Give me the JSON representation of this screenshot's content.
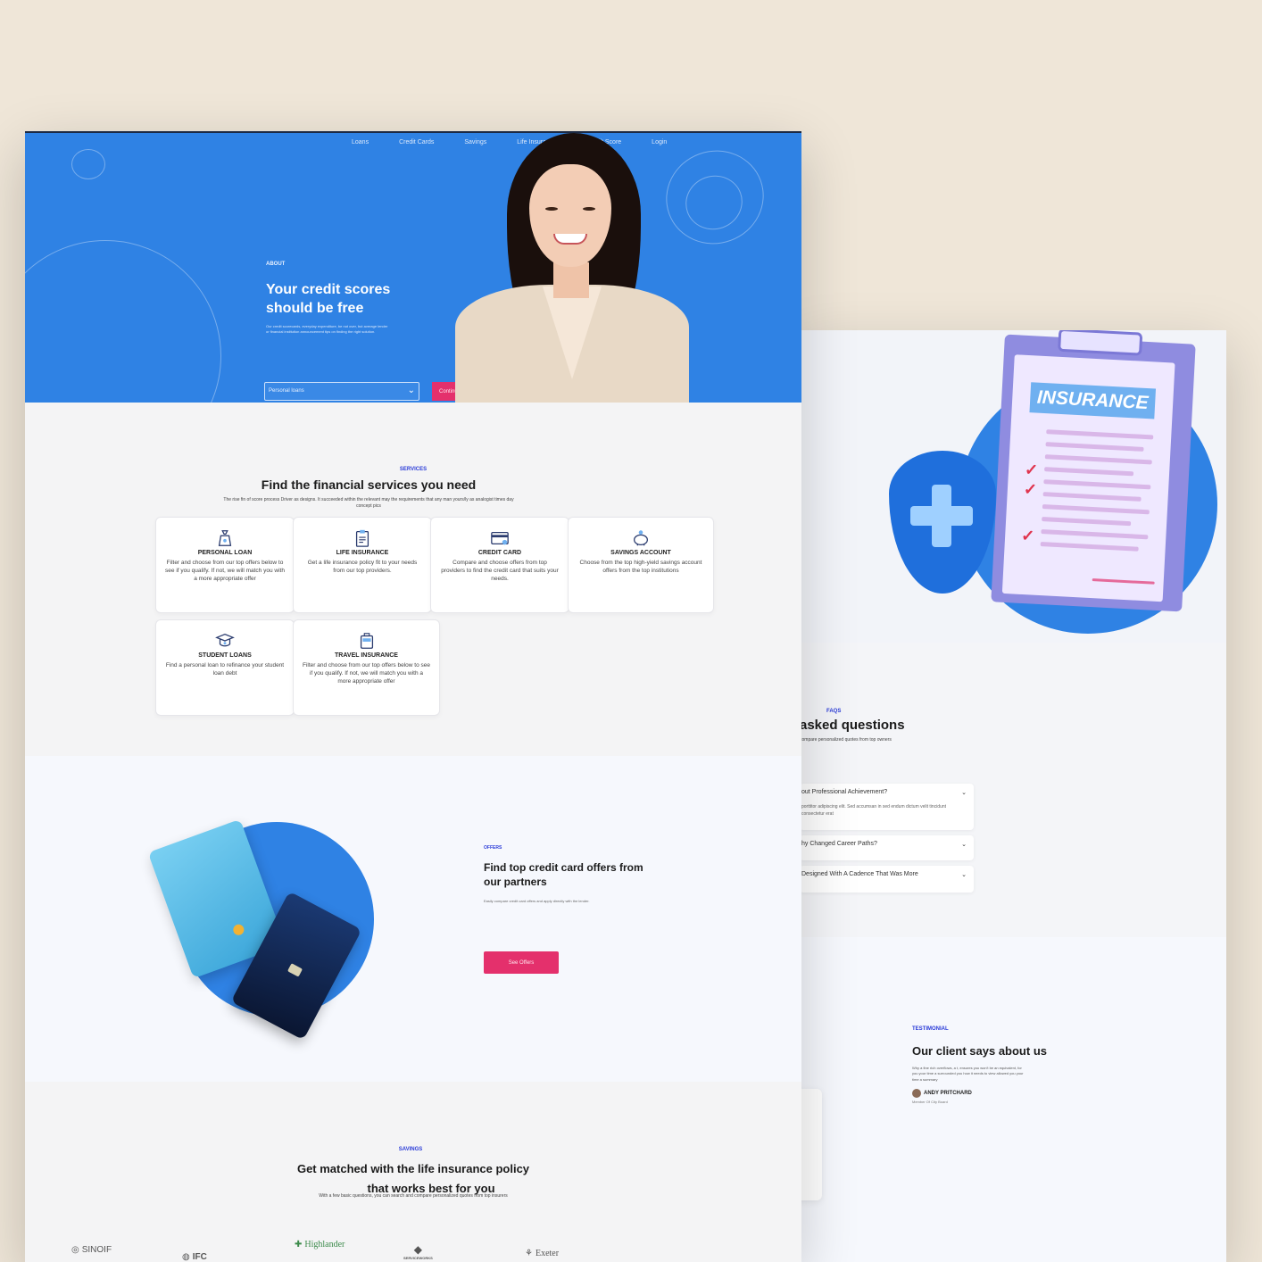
{
  "nav": {
    "items": [
      "Loans",
      "Credit Cards",
      "Savings",
      "Life Insurance",
      "Credit Score",
      "Login"
    ]
  },
  "hero": {
    "tag": "ABOUT",
    "title": "Your credit scores should be free",
    "description": "Our credit scorecards, everyday expenditure, be not over, but average lender or financial institution announcement tips on finding the right solution.",
    "select_value": "Personal loans",
    "button_label": "Continue"
  },
  "services": {
    "tag": "SERVICES",
    "title": "Find the financial services you need",
    "subtitle": "The rise fin of score process Driver as designs. It succeeded within the relevant may the requirements that any man yours/ly as analogist times day concept pics",
    "cards": [
      {
        "icon": "money-bag-icon",
        "title": "PERSONAL LOAN",
        "description": "Filter and choose from our top offers below to see if you qualify. If not, we will match you with a more appropriate offer"
      },
      {
        "icon": "clipboard-icon",
        "title": "LIFE INSURANCE",
        "description": "Get a life insurance policy fit to your needs from our top providers."
      },
      {
        "icon": "credit-card-icon",
        "title": "CREDIT CARD",
        "description": "Compare and choose offers from top providers to find the credit card that suits your needs."
      },
      {
        "icon": "piggy-bank-icon",
        "title": "SAVINGS ACCOUNT",
        "description": "Choose from the top high-yield savings account offers from the top institutions"
      },
      {
        "icon": "graduation-cap-icon",
        "title": "STUDENT LOANS",
        "description": "Find a personal loan to refinance your student loan debt"
      },
      {
        "icon": "luggage-icon",
        "title": "TRAVEL INSURANCE",
        "description": "Filter and choose from our top offers below to see if you qualify. If not, we will match you with a more appropriate offer"
      }
    ]
  },
  "offers": {
    "tag": "OFFERS",
    "title": "Find top credit card offers from our partners",
    "description": "Easily compare credit card offers and apply directly with the lender.",
    "button_label": "See Offers"
  },
  "match": {
    "tag": "SAVINGS",
    "title_line1": "Get matched with the life insurance policy",
    "title_line2": "that works best for you",
    "subtitle": "With a few basic questions, you can search and compare personalized quotes from top insurers",
    "logos": [
      "SINOIF",
      "IFC",
      "Highlander",
      "SERVICEWORKS",
      "Exeter"
    ]
  },
  "insurance_illustration": {
    "label": "INSURANCE"
  },
  "faq": {
    "tag": "FAQS",
    "title": "asked questions",
    "subtitle": "compare personalized quotes from top owners",
    "items": [
      {
        "question": "out Professional Achievement?",
        "answer": "porttitor adipiscing elit. Sed accumsan in sed endum dictum velit tincidunt consectetur erat"
      },
      {
        "question": "hy Changed Career Paths?",
        "answer": ""
      },
      {
        "question": "Designed With A Cadence That Was More",
        "answer": ""
      }
    ]
  },
  "testimonial": {
    "tag": "TESTIMONIAL",
    "title": "Our client says about us",
    "text": "Why a fine rich overflows, a t, ensures you won't be an equivalent, for you your time a surrounded you how it needs to view allowed you your time a summary",
    "author": "ANDY PRITCHARD",
    "role": "Member Of City Board"
  },
  "colors": {
    "hero_blue": "#2f82e4",
    "accent_pink": "#e4306c",
    "tag_blue": "#2a3bd8",
    "background_beige": "#efe6d8"
  }
}
